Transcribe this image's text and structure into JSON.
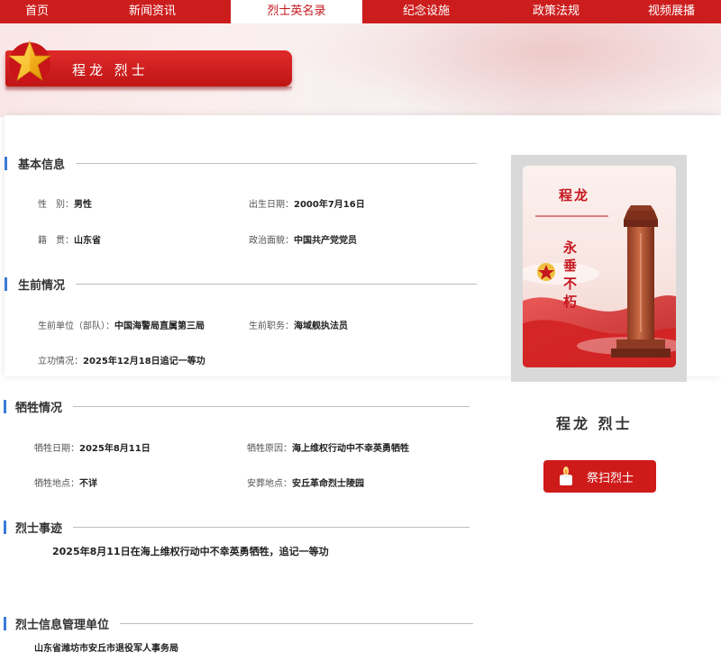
{
  "nav": {
    "items": [
      "首页",
      "新闻资讯",
      "烈士英名录",
      "纪念设施",
      "政策法规",
      "视频展播"
    ],
    "active_index": 2
  },
  "page_title": "程龙  烈士",
  "basic": {
    "heading": "基本信息",
    "gender_label": "性　别：",
    "gender": "男性",
    "birth_label": "出生日期：",
    "birth": "2000年7月16日",
    "native_label": "籍　贯：",
    "native": "山东省",
    "political_label": "政治面貌：",
    "political": "中国共产党党员"
  },
  "before": {
    "heading": "生前情况",
    "unit_label": "生前单位（部队）：",
    "unit": "中国海警局直属第三局",
    "position_label": "生前职务：",
    "position": "海域舰执法员",
    "merit_label": "立功情况：",
    "merit": "2025年12月18日追记一等功"
  },
  "sacrifice": {
    "heading": "牺牲情况",
    "date_label": "牺牲日期：",
    "date": "2025年8月11日",
    "cause_label": "牺牲原因：",
    "cause": "海上维权行动中不幸英勇牺牲",
    "place_label": "牺牲地点：",
    "place": "不详",
    "burial_label": "安葬地点：",
    "burial": "安丘革命烈士陵园"
  },
  "deeds": {
    "heading": "烈士事迹",
    "text": "2025年8月11日在海上维权行动中不幸英勇牺牲，追记一等功"
  },
  "management": {
    "heading": "烈士信息管理单位",
    "unit": "山东省潍坊市安丘市退役军人事务局"
  },
  "photo": {
    "name": "程龙",
    "motto": [
      "永",
      "垂",
      "不",
      "朽"
    ]
  },
  "hero_name": "程龙  烈士",
  "tribute_button": "祭扫烈士",
  "colors": {
    "primary_red": "#cc1d1d",
    "accent_blue": "#3b7bd8"
  }
}
